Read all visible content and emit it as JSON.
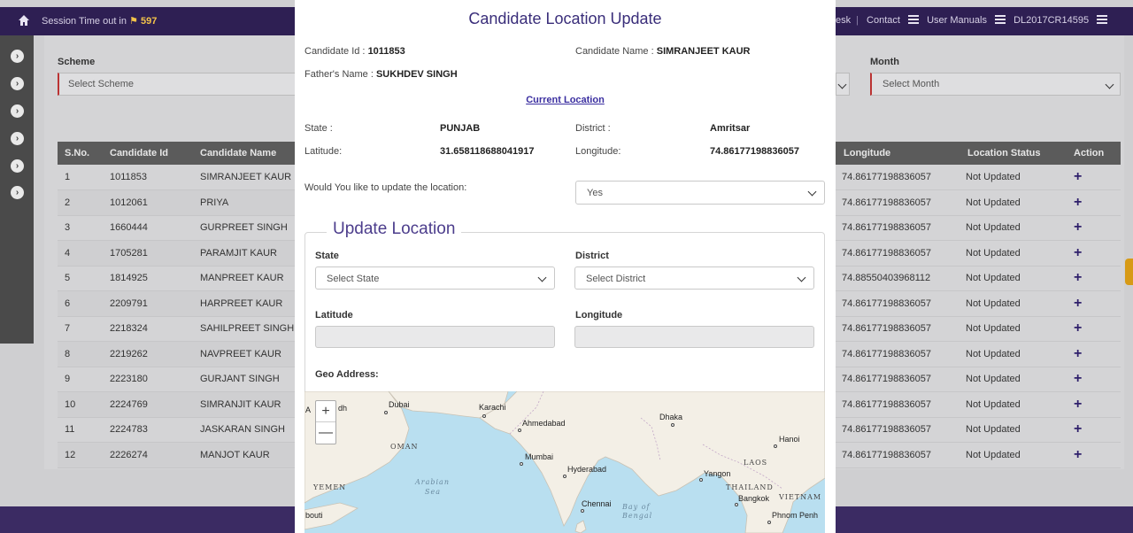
{
  "topbar": {
    "session_label": "Session Time out in",
    "session_value": "597",
    "links": [
      "esk",
      "Contact",
      "User Manuals",
      "DL2017CR14595"
    ]
  },
  "filters": {
    "scheme_label": "Scheme",
    "scheme_placeholder": "Select Scheme",
    "month_label": "Month",
    "month_placeholder": "Select Month"
  },
  "table": {
    "left_headers": [
      "S.No.",
      "Candidate Id",
      "Candidate Name"
    ],
    "right_headers": [
      "Longitude",
      "Location Status",
      "Action"
    ],
    "rows": [
      {
        "sno": "1",
        "id": "1011853",
        "name": "SIMRANJEET KAUR",
        "lon": "74.86177198836057",
        "status": "Not Updated"
      },
      {
        "sno": "2",
        "id": "1012061",
        "name": "PRIYA",
        "lon": "74.86177198836057",
        "status": "Not Updated"
      },
      {
        "sno": "3",
        "id": "1660444",
        "name": "GURPREET SINGH",
        "lon": "74.86177198836057",
        "status": "Not Updated"
      },
      {
        "sno": "4",
        "id": "1705281",
        "name": "PARAMJIT KAUR",
        "lon": "74.86177198836057",
        "status": "Not Updated"
      },
      {
        "sno": "5",
        "id": "1814925",
        "name": "MANPREET KAUR",
        "lon": "74.88550403968112",
        "status": "Not Updated"
      },
      {
        "sno": "6",
        "id": "2209791",
        "name": "HARPREET KAUR",
        "lon": "74.86177198836057",
        "status": "Not Updated"
      },
      {
        "sno": "7",
        "id": "2218324",
        "name": "SAHILPREET SINGH",
        "lon": "74.86177198836057",
        "status": "Not Updated"
      },
      {
        "sno": "8",
        "id": "2219262",
        "name": "NAVPREET KAUR",
        "lon": "74.86177198836057",
        "status": "Not Updated"
      },
      {
        "sno": "9",
        "id": "2223180",
        "name": "GURJANT SINGH",
        "lon": "74.86177198836057",
        "status": "Not Updated"
      },
      {
        "sno": "10",
        "id": "2224769",
        "name": "SIMRANJIT KAUR",
        "lon": "74.86177198836057",
        "status": "Not Updated"
      },
      {
        "sno": "11",
        "id": "2224783",
        "name": "JASKARAN SINGH",
        "lon": "74.86177198836057",
        "status": "Not Updated"
      },
      {
        "sno": "12",
        "id": "2226274",
        "name": "MANJOT KAUR",
        "lon": "74.86177198836057",
        "status": "Not Updated"
      }
    ],
    "action_glyph": "+"
  },
  "modal": {
    "title": "Candidate Location Update",
    "candidate_id_label": "Candidate Id :",
    "candidate_id": "1011853",
    "candidate_name_label": "Candidate Name :",
    "candidate_name": "SIMRANJEET KAUR",
    "father_label": "Father's Name :",
    "father_name": "SUKHDEV SINGH",
    "current_location_link": "Current Location",
    "state_label": "State :",
    "state": "PUNJAB",
    "district_label": "District :",
    "district": "Amritsar",
    "latitude_label": "Latitude:",
    "latitude": "31.658118688041917",
    "longitude_label": "Longitude:",
    "longitude": "74.86177198836057",
    "update_question": "Would You like to update the location:",
    "update_answer": "Yes",
    "update_section": {
      "legend": "Update Location",
      "state_label": "State",
      "state_placeholder": "Select State",
      "district_label": "District",
      "district_placeholder": "Select District",
      "latitude_label": "Latitude",
      "longitude_label": "Longitude",
      "geo_label": "Geo Address:"
    },
    "map": {
      "zoom_in": "+",
      "zoom_out": "—",
      "labels": {
        "a": "A",
        "dh": "dh",
        "dubai": "Dubai",
        "karachi": "Karachi",
        "ahmedabad": "Ahmedabad",
        "dhaka": "Dhaka",
        "oman": "OMAN",
        "hanoi": "Hanoi",
        "mumbai": "Mumbai",
        "hyderabad": "Hyderabad",
        "laos": "LAOS",
        "yangon": "Yangon",
        "yemen": "YEMEN",
        "arabian1": "Arabian",
        "arabian2": "Sea",
        "thailand": "THAILAND",
        "vietnam": "VIETNAM",
        "bangkok": "Bangkok",
        "chennai": "Chennai",
        "bay1": "Bay of",
        "bay2": "Bengal",
        "bouti": "bouti",
        "phnom": "Phnom Penh"
      }
    }
  },
  "colors": {
    "nav": "#2e1f53",
    "accent": "#3a2e7a",
    "session_highlight": "#f3c34a"
  }
}
